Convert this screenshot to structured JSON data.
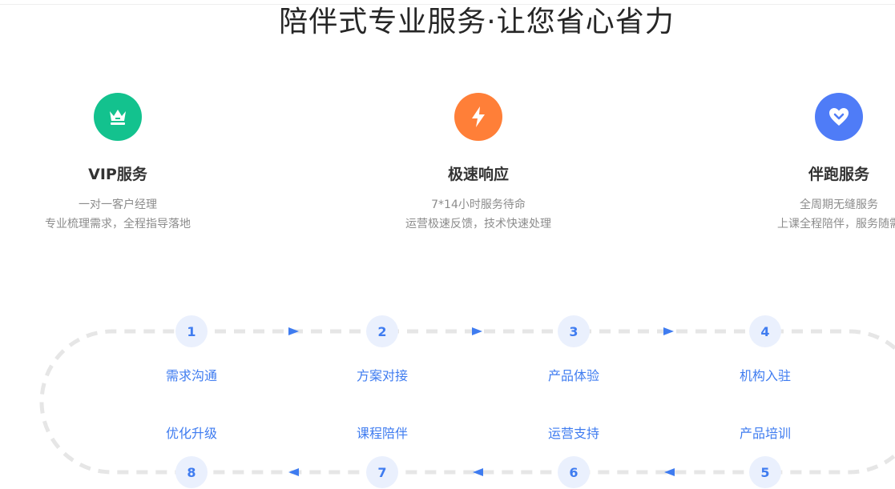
{
  "page": {
    "title": "陪伴式专业服务·让您省心省力"
  },
  "features": [
    {
      "title": "VIP服务",
      "lines": [
        "一对一客户经理",
        "专业梳理需求，全程指导落地"
      ],
      "color": "#13c28e",
      "icon": "crown-icon"
    },
    {
      "title": "极速响应",
      "lines": [
        "7*14小时服务待命",
        "运营极速反馈，技术快速处理"
      ],
      "color": "#ff7f38",
      "icon": "lightning-icon"
    },
    {
      "title": "伴跑服务",
      "lines": [
        "全周期无缝服务",
        "上课全程陪伴，服务随需"
      ],
      "color": "#4f7cf7",
      "icon": "heart-icon"
    }
  ],
  "process": {
    "accent": "#3f7cf0",
    "steps": [
      {
        "num": "1",
        "label": "需求沟通"
      },
      {
        "num": "2",
        "label": "方案对接"
      },
      {
        "num": "3",
        "label": "产品体验"
      },
      {
        "num": "4",
        "label": "机构入驻"
      },
      {
        "num": "5",
        "label": "产品培训"
      },
      {
        "num": "6",
        "label": "运营支持"
      },
      {
        "num": "7",
        "label": "课程陪伴"
      },
      {
        "num": "8",
        "label": "优化升级"
      }
    ]
  }
}
